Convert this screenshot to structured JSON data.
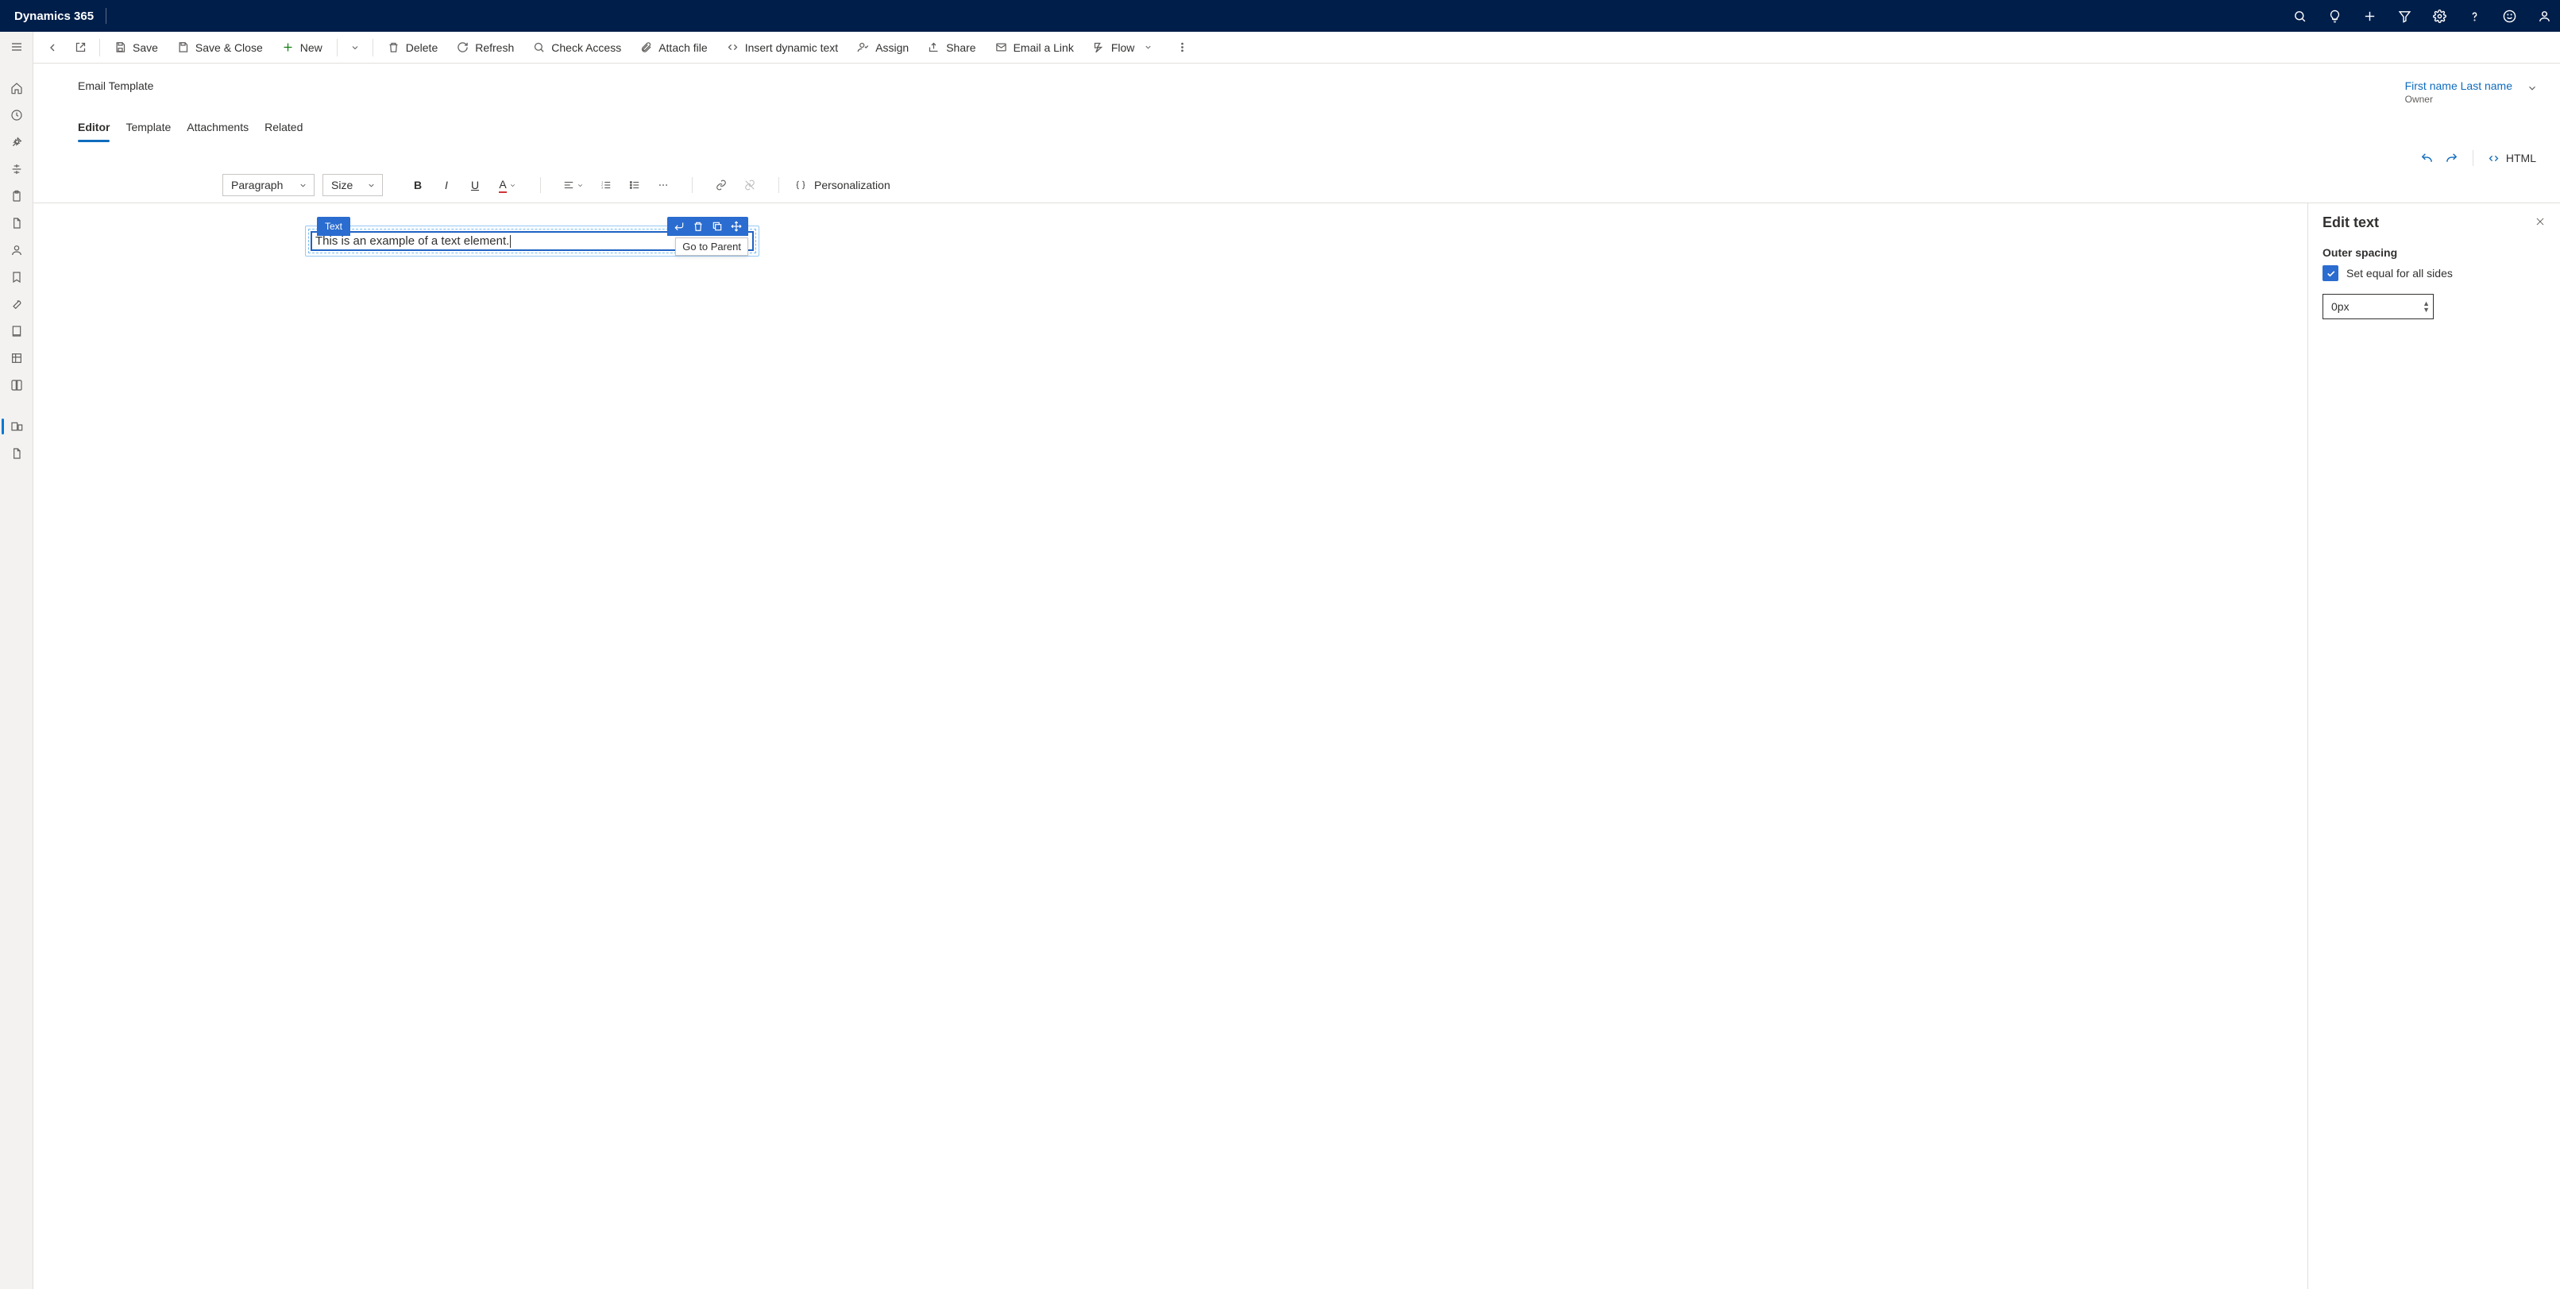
{
  "app": {
    "brand": "Dynamics 365"
  },
  "commands": {
    "save": "Save",
    "save_close": "Save & Close",
    "new": "New",
    "delete": "Delete",
    "refresh": "Refresh",
    "check_access": "Check Access",
    "attach_file": "Attach file",
    "insert_dynamic": "Insert dynamic text",
    "assign": "Assign",
    "share": "Share",
    "email_link": "Email a Link",
    "flow": "Flow"
  },
  "record": {
    "subtitle": "Email Template",
    "owner_name": "First name Last name",
    "owner_role": "Owner"
  },
  "tabs": [
    "Editor",
    "Template",
    "Attachments",
    "Related"
  ],
  "editor_tools": {
    "html": "HTML"
  },
  "formatting": {
    "para": "Paragraph",
    "size": "Size",
    "personalization": "Personalization"
  },
  "canvas": {
    "chip_label": "Text",
    "text_content": "This is an example of a text element.",
    "tooltip": "Go to Parent"
  },
  "rpanel": {
    "title": "Edit text",
    "section": "Outer spacing",
    "checkbox_label": "Set equal for all sides",
    "spacing_value": "0px"
  }
}
